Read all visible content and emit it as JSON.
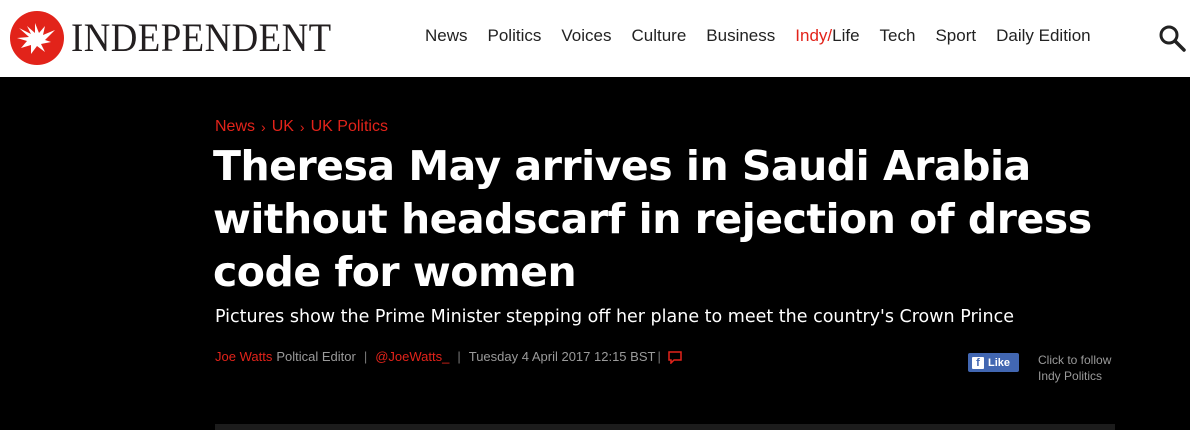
{
  "brand": {
    "name": "INDEPENDENT",
    "accent": "#e2231a"
  },
  "nav": {
    "items": [
      {
        "label": "News"
      },
      {
        "label": "Politics"
      },
      {
        "label": "Voices"
      },
      {
        "label": "Culture"
      },
      {
        "label": "Business"
      },
      {
        "label_red": "Indy/",
        "label": "Life"
      },
      {
        "label": "Tech"
      },
      {
        "label": "Sport"
      },
      {
        "label": "Daily Edition"
      }
    ],
    "search_icon": "search-icon"
  },
  "breadcrumb": [
    "News",
    "UK",
    "UK Politics"
  ],
  "article": {
    "headline": "Theresa May arrives in Saudi Arabia without headscarf in rejection of dress code for women",
    "subheadline": "Pictures show the Prime Minister stepping off her plane to meet the country's Crown Prince",
    "author": "Joe Watts",
    "role": "Poltical Editor",
    "handle": "@JoeWatts_",
    "date": "Tuesday 4 April 2017 12:15 BST",
    "comment_icon": "comment-icon"
  },
  "social": {
    "like_label": "Like",
    "follow_line1": "Click to follow",
    "follow_line2": "Indy Politics"
  }
}
